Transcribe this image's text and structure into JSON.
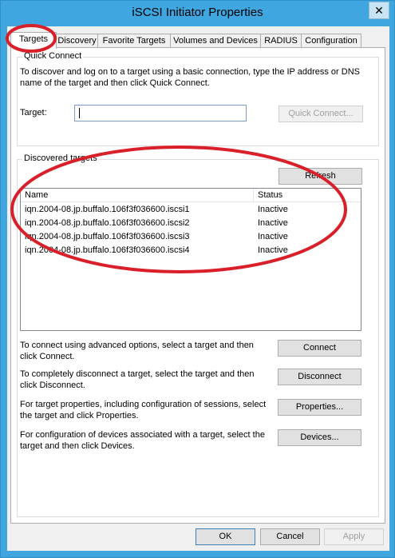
{
  "window": {
    "title": "iSCSI Initiator Properties",
    "close_symbol": "✕"
  },
  "tabs": [
    {
      "label": "Targets",
      "active": true
    },
    {
      "label": "Discovery",
      "active": false
    },
    {
      "label": "Favorite Targets",
      "active": false
    },
    {
      "label": "Volumes and Devices",
      "active": false
    },
    {
      "label": "RADIUS",
      "active": false
    },
    {
      "label": "Configuration",
      "active": false
    }
  ],
  "quick_connect": {
    "group_label": "Quick Connect",
    "description": "To discover and log on to a target using a basic connection, type the IP address or DNS name of the target and then click Quick Connect.",
    "target_label": "Target:",
    "target_value": "",
    "button_label": "Quick Connect..."
  },
  "discovered": {
    "group_label": "Discovered targets",
    "refresh_label": "Refresh",
    "columns": [
      "Name",
      "Status"
    ],
    "rows": [
      {
        "name": "iqn.2004-08.jp.buffalo.106f3f036600.iscsi1",
        "status": "Inactive"
      },
      {
        "name": "iqn.2004-08.jp.buffalo.106f3f036600.iscsi2",
        "status": "Inactive"
      },
      {
        "name": "iqn.2004-08.jp.buffalo.106f3f036600.iscsi3",
        "status": "Inactive"
      },
      {
        "name": "iqn.2004-08.jp.buffalo.106f3f036600.iscsi4",
        "status": "Inactive"
      }
    ]
  },
  "actions": [
    {
      "text": "To connect using advanced options, select a target and then click Connect.",
      "button": "Connect"
    },
    {
      "text": "To completely disconnect a target, select the target and then click Disconnect.",
      "button": "Disconnect"
    },
    {
      "text": "For target properties, including configuration of sessions, select the target and click Properties.",
      "button": "Properties..."
    },
    {
      "text": "For configuration of devices associated with a target, select the target and then click Devices.",
      "button": "Devices..."
    }
  ],
  "footer": {
    "ok": "OK",
    "cancel": "Cancel",
    "apply": "Apply"
  },
  "colors": {
    "frame": "#3fa6e0",
    "annotation": "#d9202a"
  }
}
